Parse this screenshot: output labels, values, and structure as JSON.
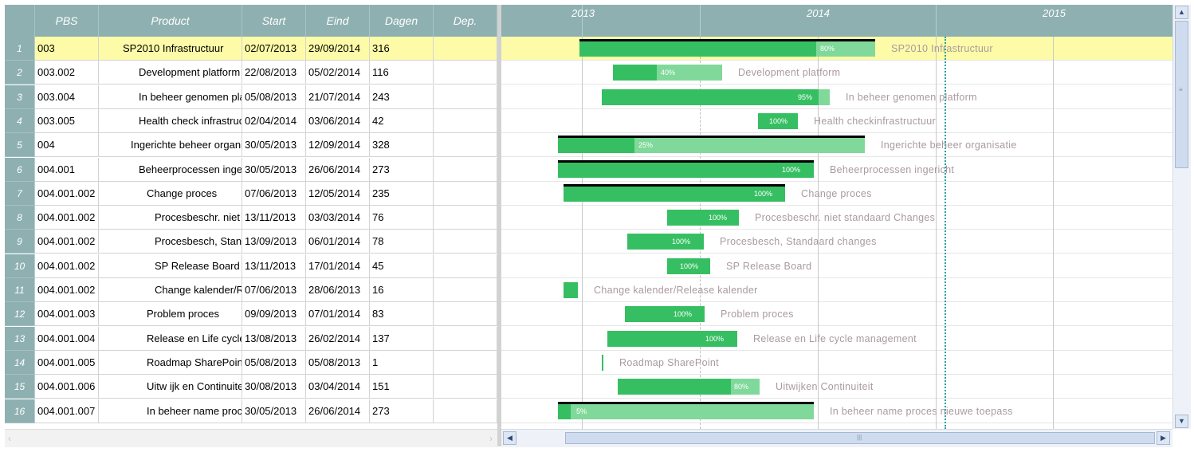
{
  "grid": {
    "columns": [
      "PBS",
      "Product",
      "Start",
      "Eind",
      "Dagen",
      "Dep."
    ],
    "rows": [
      {
        "n": "1",
        "pbs": "003",
        "product": "SP2010 Infrastructuur",
        "start": "02/07/2013",
        "end": "29/09/2014",
        "days": "316",
        "dep": ""
      },
      {
        "n": "2",
        "pbs": "003.002",
        "product": "Development platform",
        "start": "22/08/2013",
        "end": "05/02/2014",
        "days": "116",
        "dep": ""
      },
      {
        "n": "3",
        "pbs": "003.004",
        "product": "In beheer genomen pla",
        "start": "05/08/2013",
        "end": "21/07/2014",
        "days": "243",
        "dep": ""
      },
      {
        "n": "4",
        "pbs": "003.005",
        "product": "Health check infrastruc",
        "start": "02/04/2014",
        "end": "03/06/2014",
        "days": "42",
        "dep": ""
      },
      {
        "n": "5",
        "pbs": "004",
        "product": "Ingerichte beheer organi",
        "start": "30/05/2013",
        "end": "12/09/2014",
        "days": "328",
        "dep": ""
      },
      {
        "n": "6",
        "pbs": "004.001",
        "product": "Beheerprocessen inge",
        "start": "30/05/2013",
        "end": "26/06/2014",
        "days": "273",
        "dep": ""
      },
      {
        "n": "7",
        "pbs": "004.001.002",
        "product": "Change proces",
        "start": "07/06/2013",
        "end": "12/05/2014",
        "days": "235",
        "dep": ""
      },
      {
        "n": "8",
        "pbs": "004.001.002",
        "product": "Procesbeschr. niet",
        "start": "13/11/2013",
        "end": "03/03/2014",
        "days": "76",
        "dep": ""
      },
      {
        "n": "9",
        "pbs": "004.001.002",
        "product": "Procesbesch, Stand",
        "start": "13/09/2013",
        "end": "06/01/2014",
        "days": "78",
        "dep": ""
      },
      {
        "n": "10",
        "pbs": "004.001.002",
        "product": "SP Release Board",
        "start": "13/11/2013",
        "end": "17/01/2014",
        "days": "45",
        "dep": ""
      },
      {
        "n": "11",
        "pbs": "004.001.002",
        "product": "Change kalender/Re",
        "start": "07/06/2013",
        "end": "28/06/2013",
        "days": "16",
        "dep": ""
      },
      {
        "n": "12",
        "pbs": "004.001.003",
        "product": "Problem proces",
        "start": "09/09/2013",
        "end": "07/01/2014",
        "days": "83",
        "dep": ""
      },
      {
        "n": "13",
        "pbs": "004.001.004",
        "product": "Release en Life cycle",
        "start": "13/08/2013",
        "end": "26/02/2014",
        "days": "137",
        "dep": ""
      },
      {
        "n": "14",
        "pbs": "004.001.005",
        "product": "Roadmap SharePoint",
        "start": "05/08/2013",
        "end": "05/08/2013",
        "days": "1",
        "dep": ""
      },
      {
        "n": "15",
        "pbs": "004.001.006",
        "product": "Uitw ijk en Continuiteit",
        "start": "30/08/2013",
        "end": "03/04/2014",
        "days": "151",
        "dep": ""
      },
      {
        "n": "16",
        "pbs": "004.001.007",
        "product": "In beheer name proce",
        "start": "30/05/2013",
        "end": "26/06/2014",
        "days": "273",
        "dep": ""
      }
    ]
  },
  "gantt": {
    "years": [
      "2013",
      "2014",
      "2015"
    ],
    "colors": {
      "bar_done": "#36bf62",
      "bar_remaining": "#80d99a",
      "summary_top": "#000000",
      "selected_row": "#fdfba7",
      "today": "#2aa0a0"
    },
    "bars": [
      {
        "pct_label": "80%",
        "progress": 0.8,
        "summary": true,
        "label": "SP2010 Infrastructuur"
      },
      {
        "pct_label": "40%",
        "progress": 0.4,
        "summary": false,
        "label": "Development platform"
      },
      {
        "pct_label": "95%",
        "progress": 0.95,
        "summary": false,
        "label": "In beheer genomen platform"
      },
      {
        "pct_label": "100%",
        "progress": 1.0,
        "summary": false,
        "label": "Health checkinfrastructuur"
      },
      {
        "pct_label": "25%",
        "progress": 0.25,
        "summary": true,
        "label": "Ingerichte beheer organisatie"
      },
      {
        "pct_label": "100%",
        "progress": 1.0,
        "summary": true,
        "label": "Beheerprocessen ingericht"
      },
      {
        "pct_label": "100%",
        "progress": 1.0,
        "summary": true,
        "label": "Change proces"
      },
      {
        "pct_label": "100%",
        "progress": 1.0,
        "summary": false,
        "label": "Procesbeschr. niet standaard Changes"
      },
      {
        "pct_label": "100%",
        "progress": 1.0,
        "summary": false,
        "label": "Procesbesch, Standaard changes"
      },
      {
        "pct_label": "100%",
        "progress": 1.0,
        "summary": false,
        "label": "SP Release Board"
      },
      {
        "pct_label": "",
        "progress": 1.0,
        "summary": false,
        "label": "Change kalender/Release kalender"
      },
      {
        "pct_label": "100%",
        "progress": 1.0,
        "summary": false,
        "label": "Problem proces"
      },
      {
        "pct_label": "100%",
        "progress": 1.0,
        "summary": false,
        "label": "Release en Life cycle management"
      },
      {
        "pct_label": "",
        "progress": 1.0,
        "summary": false,
        "label": "Roadmap SharePoint"
      },
      {
        "pct_label": "80%",
        "progress": 0.8,
        "summary": false,
        "label": "Uitwijken Continuiteit"
      },
      {
        "pct_label": "5%",
        "progress": 0.05,
        "summary": true,
        "label": "In beheer name proces nieuwe toepass"
      }
    ]
  },
  "icons": {
    "scroll_up": "▲",
    "scroll_down": "▼",
    "scroll_left": "◀",
    "scroll_right": "▶",
    "grid_left": "‹",
    "grid_right": "›",
    "grip_v": "≡",
    "grip_h": "|||"
  }
}
